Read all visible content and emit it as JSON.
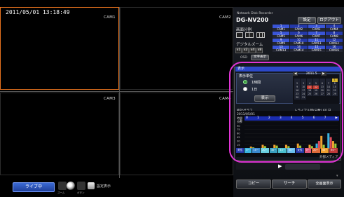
{
  "datetime": "2011/05/01 13:18:49",
  "cameras": [
    {
      "label": "CAM1"
    },
    {
      "label": "CAM2"
    },
    {
      "label": "CAM3"
    },
    {
      "label": "CAM4"
    }
  ],
  "bottom_bar": {
    "live_label": "ライブ中",
    "zoom_label": "ズーム",
    "seq_label": "ボタン",
    "settings_label": "設定表示"
  },
  "panel": {
    "subtitle": "Network Disk Recorder",
    "model": "DG-NV200",
    "settings_btn": "設定",
    "logout_btn": "ログアウト",
    "screen_split_label": "画面分割",
    "digital_zoom_label": "デジタルズーム",
    "zoom_levels": [
      "x1",
      "x2",
      "x4",
      "x8"
    ],
    "cam_label_btn": "文字表示",
    "osd_label": "OSD",
    "cam_grid": [
      {
        "num": "1",
        "label": "CAM1"
      },
      {
        "num": "2",
        "label": "CAM2"
      },
      {
        "num": "3",
        "label": "CAM3"
      },
      {
        "num": "4",
        "label": "CAM4"
      },
      {
        "num": "5",
        "label": "CAM5"
      },
      {
        "num": "6",
        "label": "CAM6"
      },
      {
        "num": "7",
        "label": "CAM7"
      },
      {
        "num": "8",
        "label": "CAM8"
      },
      {
        "num": "9",
        "label": "CAM9"
      },
      {
        "num": "10",
        "label": "CAM10"
      },
      {
        "num": "11",
        "label": "CAM11"
      },
      {
        "num": "12",
        "label": "CAM12"
      },
      {
        "num": "13",
        "label": "CAM13"
      },
      {
        "num": "14",
        "label": "CAM14"
      },
      {
        "num": "15",
        "label": "CAM15"
      },
      {
        "num": "16",
        "label": "CAM16"
      }
    ],
    "popup": {
      "title": "表示",
      "unit_label": "表示単位",
      "option_hour": "1時間",
      "option_day": "1日",
      "show_btn": "表示",
      "calendar_month": "2011.5",
      "calendar_days": [
        "",
        "",
        "",
        "",
        "",
        "",
        "1",
        "2",
        "3",
        "4",
        "5",
        "6",
        "7",
        "8",
        "9",
        "10",
        "11",
        "12",
        "13",
        "14",
        "15",
        "16",
        "17",
        "18",
        "19",
        "20",
        "21",
        "22",
        "23",
        "24",
        "25",
        "26",
        "27",
        "28",
        "29",
        "30",
        "31"
      ],
      "graph_title": "統計グラフ",
      "graph_right": "トライアル時(分数) 60 日",
      "graph_date": "2011/05/01",
      "graph_ylabel": "時間 人数",
      "media_label": "外部メディア"
    },
    "bottom_buttons": {
      "copy": "コピー",
      "search": "サーチ",
      "fullscreen": "全画面表示"
    }
  },
  "chart_data": {
    "type": "bar",
    "title": "統計グラフ",
    "categories": [
      "0",
      "1",
      "2",
      "3",
      "4",
      "5",
      "6",
      "7"
    ],
    "series": [
      {
        "name": "男性",
        "color": "#3ab4e0",
        "values": [
          0,
          0,
          0,
          0,
          0,
          0,
          20,
          60
        ]
      },
      {
        "name": "女性",
        "color": "#e04a5a",
        "values": [
          0,
          0,
          0,
          0,
          0,
          0,
          30,
          45
        ]
      },
      {
        "name": "その他",
        "color": "#f0a030",
        "values": [
          8,
          15,
          15,
          15,
          20,
          15,
          50,
          30
        ]
      },
      {
        "name": "合計",
        "color": "#9acb3a",
        "values": [
          5,
          10,
          12,
          10,
          12,
          10,
          15,
          20
        ]
      }
    ],
    "ylim": [
      0,
      110
    ],
    "yticks": [
      105,
      90,
      75,
      60,
      45,
      30,
      15
    ],
    "legend_left": [
      "男性",
      "0~",
      "10~",
      "20~",
      "30~",
      "40~",
      "50~"
    ],
    "legend_right": [
      "女性",
      "0~",
      "20~",
      "40~",
      "60~"
    ]
  }
}
